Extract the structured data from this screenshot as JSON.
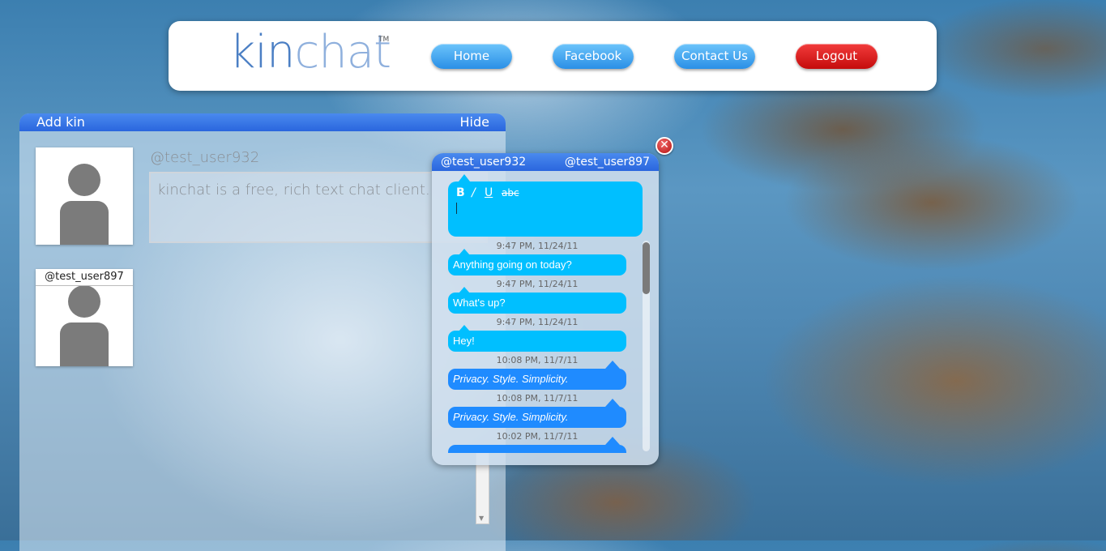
{
  "header": {
    "logo_part1": "kin",
    "logo_part2": "chat",
    "trademark": "TM",
    "nav": [
      {
        "label": "Home"
      },
      {
        "label": "Facebook"
      },
      {
        "label": "Contact Us"
      },
      {
        "label": "Logout"
      }
    ]
  },
  "kin_panel": {
    "add_label": "Add kin",
    "hide_label": "Hide",
    "profile_name": "@test_user932",
    "status": "kinchat is a free, rich text chat client.",
    "kin_list": [
      {
        "username": "@test_user897"
      }
    ]
  },
  "chat": {
    "me": "@test_user932",
    "them": "@test_user897",
    "format_buttons": [
      "B",
      "/",
      "U",
      "abc"
    ],
    "messages": [
      {
        "time": "9:47 PM, 11/24/11",
        "text": "Anything going on today?",
        "direction": "in"
      },
      {
        "time": "9:47 PM, 11/24/11",
        "text": "What's up?",
        "direction": "in"
      },
      {
        "time": "9:47 PM, 11/24/11",
        "text": "Hey!",
        "direction": "in"
      },
      {
        "time": "10:08 PM, 11/7/11",
        "text": "Privacy. Style. Simplicity.",
        "direction": "out"
      },
      {
        "time": "10:08 PM, 11/7/11",
        "text": "Privacy. Style. Simplicity.",
        "direction": "out"
      },
      {
        "time": "10:02 PM, 11/7/11",
        "text": "",
        "direction": "out"
      }
    ]
  },
  "colors": {
    "accent_blue": "#2a66de",
    "bubble_in": "#00bfff",
    "bubble_out": "#1f8bff",
    "logout_red": "#d41414"
  }
}
